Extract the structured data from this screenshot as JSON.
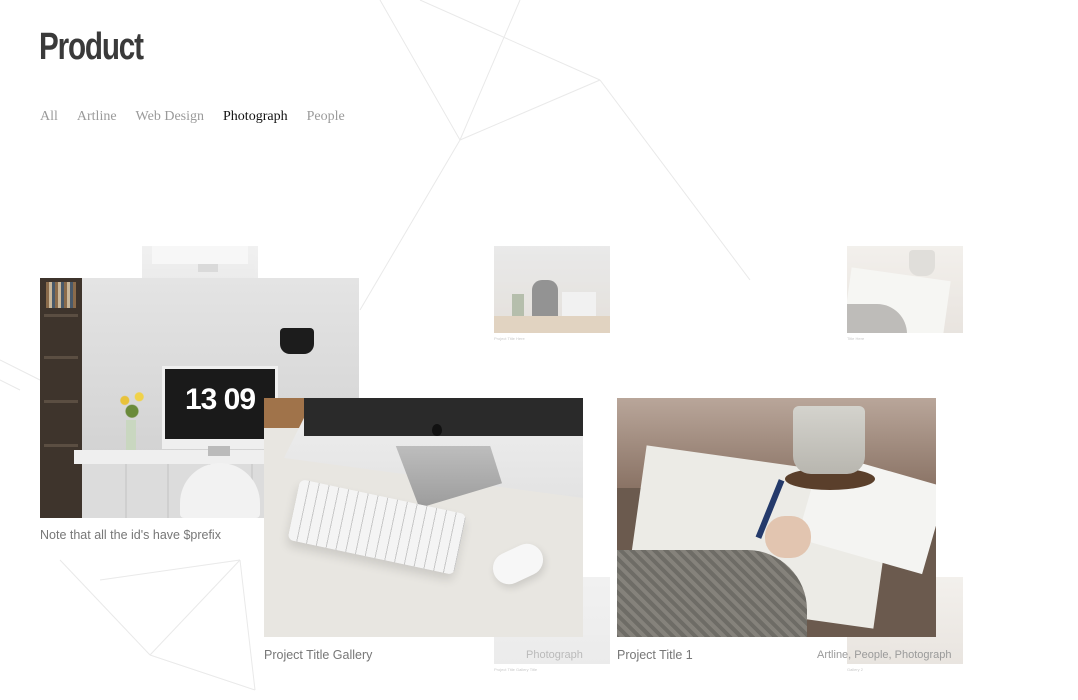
{
  "page": {
    "title": "Product"
  },
  "filters": {
    "items": [
      {
        "label": "All"
      },
      {
        "label": "Artline"
      },
      {
        "label": "Web Design"
      },
      {
        "label": "Photograph"
      },
      {
        "label": "People"
      }
    ],
    "active": "Photograph"
  },
  "cards": [
    {
      "caption": "Note that all the id's have $prefix",
      "image": "desk-imac-photo",
      "clock": "13 09"
    },
    {
      "caption": "Project Title Gallery",
      "image": "keyboard-mouse-photo",
      "category": "Photograph"
    },
    {
      "caption": "Project Title 1",
      "image": "writing-hand-photo",
      "category": "Artline, People, Photograph"
    }
  ],
  "thumbnails": [
    {
      "image": "imac-thumb",
      "caption": ""
    },
    {
      "image": "desk-laptop-thumb",
      "caption": "Project Title Here"
    },
    {
      "image": "writing-thumb",
      "caption": "Title Here"
    },
    {
      "image": "keyboard-thumb",
      "caption": "Project Title Gallery Title"
    },
    {
      "image": "writing-thumb-2",
      "caption": "Gallery 2"
    }
  ]
}
